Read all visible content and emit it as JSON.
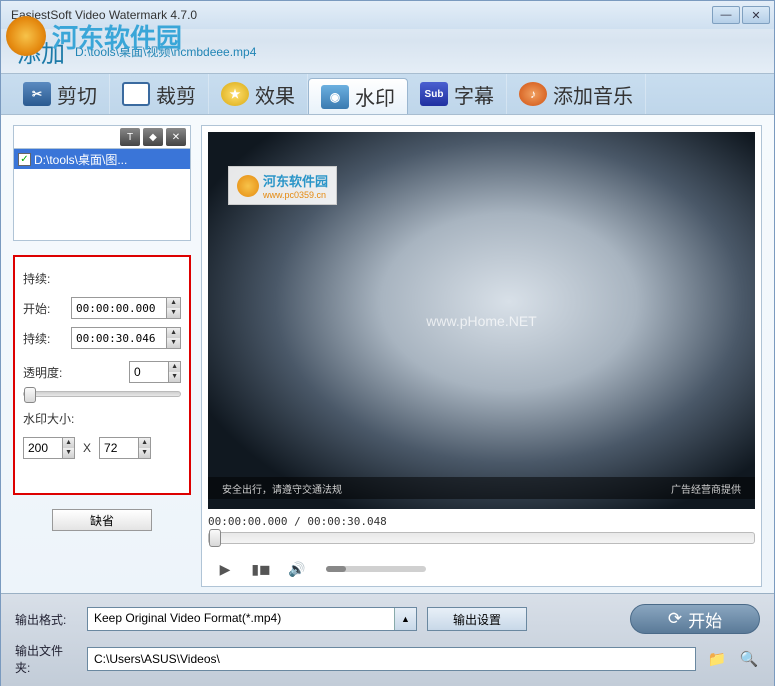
{
  "window": {
    "title": "EasiestSoft Video Watermark 4.7.0",
    "brand_name": "河东软件园",
    "brand_url": "www.pc0359.cn"
  },
  "header": {
    "add_label": "添加",
    "file_path": "D:\\tools\\桌面\\视频\\ncmbdeee.mp4"
  },
  "tabs": {
    "cut": "剪切",
    "crop": "裁剪",
    "effect": "效果",
    "watermark": "水印",
    "subtitle": "字幕",
    "music": "添加音乐",
    "sub_badge": "Sub"
  },
  "list": {
    "item0": "D:\\tools\\桌面\\图..."
  },
  "form": {
    "duration_label": "持续:",
    "start_label": "开始:",
    "start_value": "00:00:00.000",
    "duration_value_label": "持续:",
    "duration_value": "00:00:30.046",
    "opacity_label": "透明度:",
    "opacity_value": "0",
    "size_label": "水印大小:",
    "width_value": "200",
    "x_label": "X",
    "height_value": "72",
    "default_btn": "缺省"
  },
  "preview": {
    "tiny_brand": "河东软件园",
    "tiny_brand_url": "www.pc0359.cn",
    "center_url": "www.pHome.NET",
    "bottom_left": "安全出行，请遵守交通法规",
    "bottom_right": "广告经营商提供",
    "time_display": "00:00:00.000 / 00:00:30.048"
  },
  "footer": {
    "format_label": "输出格式:",
    "format_value": "Keep Original Video Format(*.mp4)",
    "settings_btn": "输出设置",
    "start_btn": "开始",
    "folder_label": "输出文件夹:",
    "folder_value": "C:\\Users\\ASUS\\Videos\\"
  }
}
